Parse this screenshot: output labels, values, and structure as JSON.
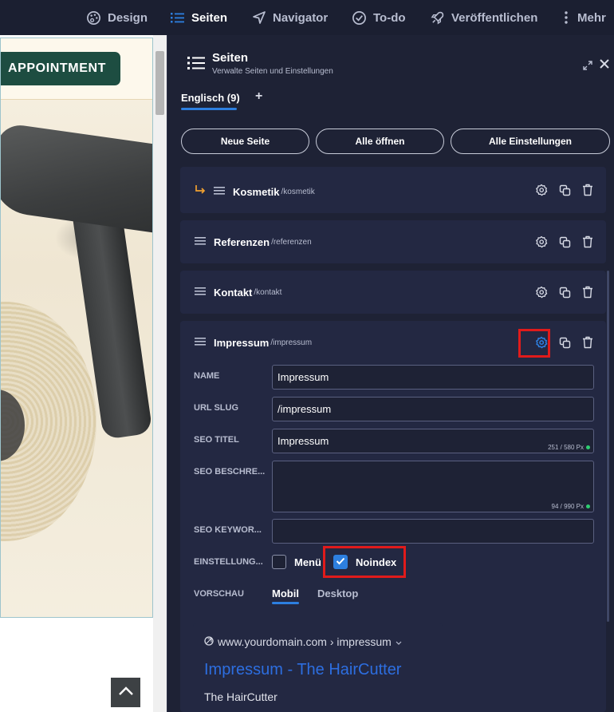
{
  "topnav": {
    "design": "Design",
    "seiten": "Seiten",
    "navigator": "Navigator",
    "todo": "To-do",
    "publish": "Veröffentlichen",
    "more": "Mehr"
  },
  "preview": {
    "appointment_button": "APPOINTMENT"
  },
  "panel": {
    "title": "Seiten",
    "subtitle": "Verwalte Seiten und Einstellungen",
    "language_tab": "Englisch (9)",
    "add_language": "+",
    "buttons": {
      "new_page": "Neue Seite",
      "open_all": "Alle öffnen",
      "all_settings": "Alle Einstellungen"
    },
    "pages": [
      {
        "name": "Kosmetik",
        "slug": "/kosmetik"
      },
      {
        "name": "Referenzen",
        "slug": "/referenzen"
      },
      {
        "name": "Kontakt",
        "slug": "/kontakt"
      },
      {
        "name": "Impressum",
        "slug": "/impressum"
      }
    ],
    "settings": {
      "name_label": "NAME",
      "name_value": "Impressum",
      "slug_label": "URL SLUG",
      "slug_value": "/impressum",
      "seo_title_label": "SEO TITEL",
      "seo_title_value": "Impressum",
      "seo_title_counter": "251 / 580 Px",
      "seo_desc_label": "SEO BESCHRE...",
      "seo_desc_value": "",
      "seo_desc_counter": "94 / 990 Px",
      "seo_keywords_label": "SEO KEYWOR...",
      "seo_keywords_value": "",
      "settings_label": "EINSTELLUNG...",
      "menu_label": "Menü",
      "menu_checked": false,
      "noindex_label": "Noindex",
      "noindex_checked": true,
      "preview_label": "VORSCHAU",
      "tab_mobile": "Mobil",
      "tab_desktop": "Desktop"
    },
    "serp": {
      "url": "www.yourdomain.com › impressum",
      "title": "Impressum - The HairCutter",
      "site": "The HairCutter"
    }
  },
  "colors": {
    "accent": "#2d7fe0",
    "highlight": "#e01b1b",
    "panel_bg": "#1e2235",
    "row_bg": "#232842",
    "brand_green": "#1d4d41"
  }
}
